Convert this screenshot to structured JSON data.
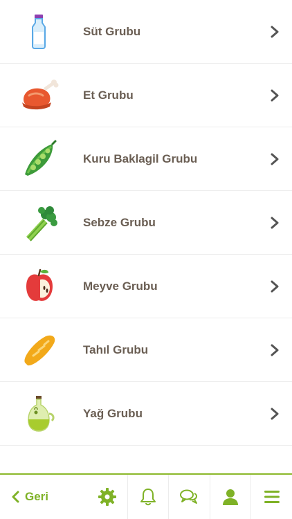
{
  "categories": [
    {
      "label": "Süt Grubu",
      "icon": "milk-bottle-icon"
    },
    {
      "label": "Et Grubu",
      "icon": "roast-chicken-icon"
    },
    {
      "label": "Kuru Baklagil Grubu",
      "icon": "peas-pod-icon"
    },
    {
      "label": "Sebze Grubu",
      "icon": "celery-icon"
    },
    {
      "label": "Meyve Grubu",
      "icon": "apple-icon"
    },
    {
      "label": "Tahıl Grubu",
      "icon": "bread-icon"
    },
    {
      "label": "Yağ Grubu",
      "icon": "olive-oil-icon"
    }
  ],
  "tabbar": {
    "back_label": "Geri",
    "tabs": [
      "gear-icon",
      "bell-icon",
      "chat-icon",
      "user-icon",
      "menu-icon"
    ]
  },
  "colors": {
    "accent": "#7fb227",
    "text": "#6a5e53",
    "divider": "#ececec"
  }
}
